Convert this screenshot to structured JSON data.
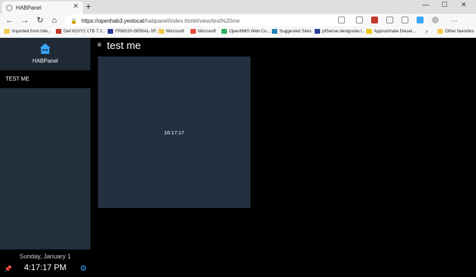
{
  "browser": {
    "tab_title": "HABPanel",
    "tab_close": "✕",
    "new_tab": "+",
    "win_minimize": "—",
    "win_maximize": "☐",
    "win_close": "✕",
    "url_main": "https://openhab3.yeslocal",
    "url_rest": "/habpanel/index.html#/view/test%20me"
  },
  "bookmarks": {
    "items": [
      {
        "label": "Imported from Inte...",
        "color": "#f2c94c"
      },
      {
        "label": "Dell 62VY2 1TB 7.2...",
        "color": "#c0392b"
      },
      {
        "label": "FRM220-SERIAL-SF...",
        "color": "#2c3e94"
      },
      {
        "label": "Microsoft",
        "color": "#f2c94c"
      },
      {
        "label": "Microsoft",
        "color": "#e74c3c"
      },
      {
        "label": "OpenNMS Web Co...",
        "color": "#27ae60"
      },
      {
        "label": "Suggested Sites",
        "color": "#2980b9"
      },
      {
        "label": "pfSense.designsite.l...",
        "color": "#2c3e94"
      },
      {
        "label": "Approximate Diesel...",
        "color": "#f1c40f"
      }
    ],
    "more": "›",
    "other_favorites": "Other favorites"
  },
  "sidebar": {
    "brand": "HABPanel",
    "menu_item": "TEST ME",
    "date": "Sunday, January 1",
    "time": "4:17:17 PM"
  },
  "main": {
    "title": "test me",
    "widget_value": "16:17:17"
  },
  "icons": {
    "hamburger": "≡",
    "pin": "📌",
    "gear": "⚙",
    "back": "←",
    "forward": "→",
    "refresh": "↻",
    "home": "⌂",
    "lock": "🔒"
  },
  "colors": {
    "sidebar_panel": "#222f3d",
    "widget_bg": "#223041",
    "accent": "#3aa7ff"
  }
}
